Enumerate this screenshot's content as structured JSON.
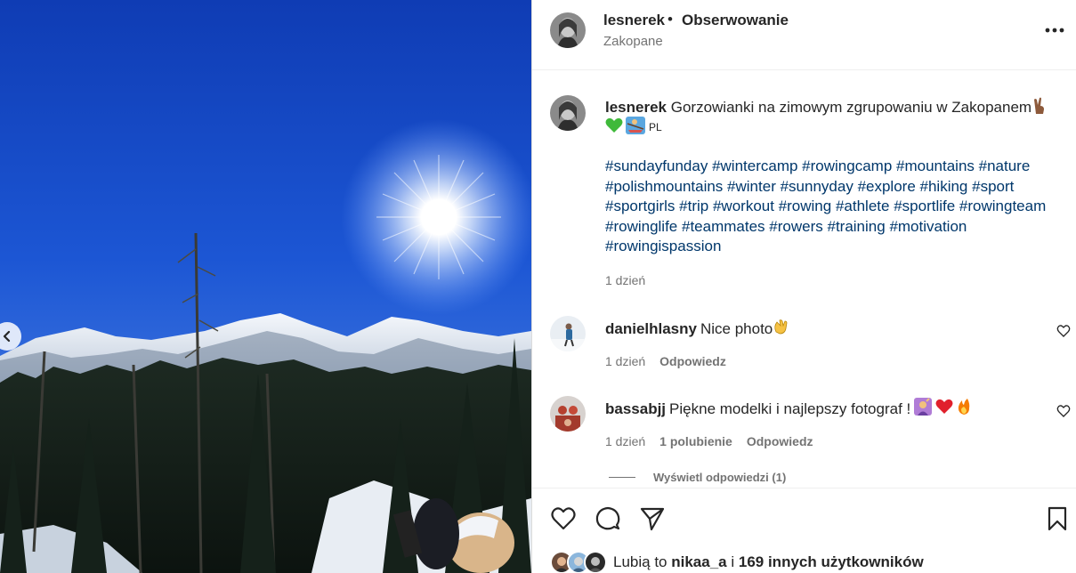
{
  "post": {
    "username": "lesnerek",
    "separator": "•",
    "follow_label": "Obserwowanie",
    "location": "Zakopane",
    "more_icon": "more-horizontal-icon"
  },
  "caption": {
    "username": "lesnerek",
    "text": "Gorzowianki na zimowym zgrupowaniu w Zakopanem",
    "emoji_suffix": [
      "victory-hand-emoji"
    ],
    "emoji_line": [
      "green-heart-emoji",
      "rowing-person-emoji"
    ],
    "flag_text": "PL",
    "hashtags": [
      "#sundayfunday",
      "#wintercamp",
      "#rowingcamp",
      "#mountains",
      "#nature",
      "#polishmountains",
      "#winter",
      "#sunnyday",
      "#explore",
      "#hiking",
      "#sport",
      "#sportgirls",
      "#trip",
      "#workout",
      "#rowing",
      "#athlete",
      "#sportlife",
      "#rowingteam",
      "#rowinglife",
      "#teammates",
      "#rowers",
      "#training",
      "#motivation",
      "#rowingispassion"
    ],
    "time": "1 dzień"
  },
  "comments": [
    {
      "username": "danielhlasny",
      "text": "Nice photo",
      "emojis": [
        "clapping-hands-emoji"
      ],
      "time": "1 dzień",
      "likes": "",
      "reply_label": "Odpowiedz"
    },
    {
      "username": "bassabjj",
      "text": "Piękne modelki i najlepszy fotograf !",
      "emojis": [
        "woman-raising-hand-emoji",
        "red-heart-emoji",
        "fire-emoji"
      ],
      "time": "1 dzień",
      "likes": "1 polubienie",
      "reply_label": "Odpowiedz"
    }
  ],
  "view_replies_label": "Wyświetl odpowiedzi (1)",
  "actions": {
    "icons": [
      "heart-icon",
      "comment-icon",
      "share-icon",
      "bookmark-icon"
    ]
  },
  "likes": {
    "prefix": "Lubią to",
    "user": "nikaa_a",
    "conjunction": "i",
    "others": "169 innych użytkowników"
  },
  "colors": {
    "hashtag": "#00376b",
    "secondary_text": "#737373",
    "primary_text": "#262626",
    "sky": "#1a4fc9"
  }
}
